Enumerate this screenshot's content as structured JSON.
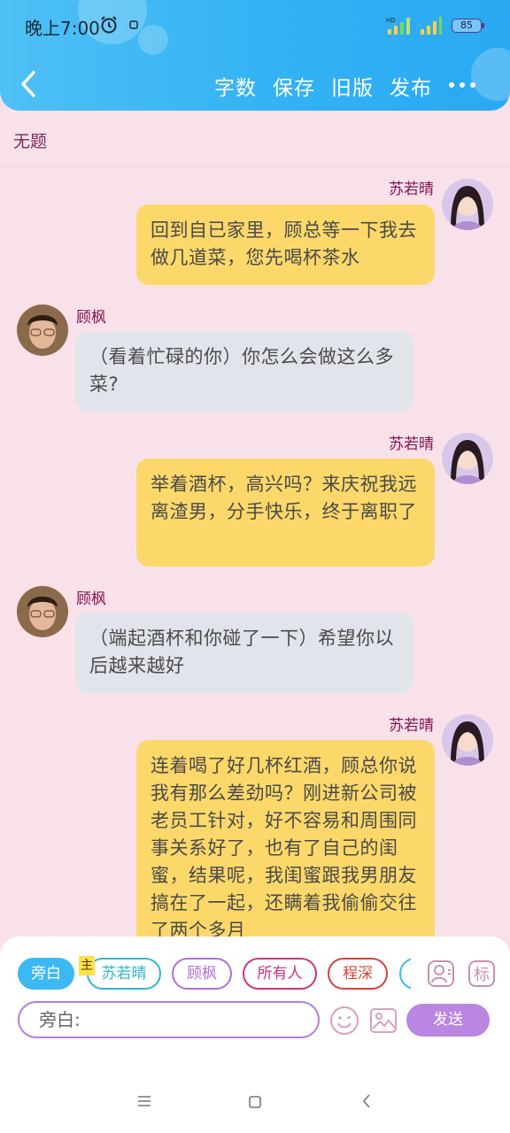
{
  "status": {
    "time": "晚上7:00",
    "battery": "85"
  },
  "toolbar": {
    "word_count": "字数",
    "save": "保存",
    "old_version": "旧版",
    "publish": "发布"
  },
  "title": "无题",
  "messages": [
    {
      "side": "right",
      "name": "苏若晴",
      "text": "回到自已家里，顾总等一下我去做几道菜，您先喝杯茶水"
    },
    {
      "side": "left",
      "name": "顾枫",
      "text": "（看着忙碌的你）你怎么会做这么多菜?"
    },
    {
      "side": "right",
      "name": "苏若晴",
      "text": "举着酒杯，高兴吗？来庆祝我远离渣男，分手快乐，终于离职了"
    },
    {
      "side": "left",
      "name": "顾枫",
      "text": "（端起酒杯和你碰了一下）希望你以后越来越好"
    },
    {
      "side": "right",
      "name": "苏若晴",
      "text": "连着喝了好几杯红酒，顾总你说我有那么差劲吗？刚进新公司被老员工针对，好不容易和周围同事关系好了，也有了自己的闺蜜，结果呢，我闺蜜跟我男朋友搞在了一起，还瞒着我偷偷交往了两个多月"
    }
  ],
  "panel": {
    "chips": [
      {
        "label": "旁白",
        "active": true,
        "color": "#3cb9f2"
      },
      {
        "label": "苏若晴",
        "active": false,
        "color": "#2fb8c9"
      },
      {
        "label": "顾枫",
        "active": false,
        "color": "#b070d8"
      },
      {
        "label": "所有人",
        "active": false,
        "color": "#c8357f"
      },
      {
        "label": "程深",
        "active": false,
        "color": "#d9403a"
      }
    ],
    "main_tag": "主",
    "input_value": "旁白:",
    "send": "发送"
  },
  "colors": {
    "header": "#35b3f4",
    "background": "#f9e1ea",
    "bubble_right": "#fcd86a",
    "bubble_left": "#e2e4ec",
    "name": "#80154f",
    "send": "#b986e2"
  },
  "icons": [
    "alarm-icon",
    "signal-icon",
    "battery-icon",
    "back-icon",
    "more-icon",
    "person-icon",
    "tag-icon",
    "emoji-icon",
    "image-icon",
    "nav-menu-icon",
    "nav-home-icon",
    "nav-back-icon"
  ]
}
